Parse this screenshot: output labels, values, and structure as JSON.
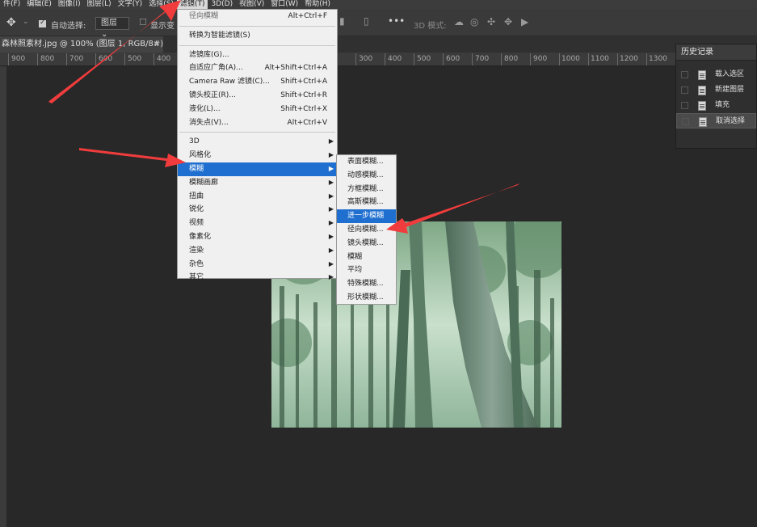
{
  "menubar": {
    "items": [
      "件(F)",
      "编辑(E)",
      "图像(I)",
      "图层(L)",
      "文字(Y)",
      "选择(S)",
      "滤镜(T)",
      "3D(D)",
      "视图(V)",
      "窗口(W)",
      "帮助(H)"
    ]
  },
  "options": {
    "auto_select_label": "自动选择:",
    "auto_select_value": "图层",
    "show_transform_label": "显示变",
    "mode_3d_label": "3D 模式:"
  },
  "document_tab": {
    "title": "森林照素材.jpg @ 100% (图层 1, RGB/8#) *",
    "close": "×"
  },
  "ruler": {
    "labels": [
      "900",
      "800",
      "700",
      "600",
      "500",
      "400",
      "300",
      "400",
      "500",
      "600",
      "700",
      "800",
      "900",
      "1000",
      "1100",
      "1200",
      "1300"
    ]
  },
  "history": {
    "title": "历史记录",
    "items": [
      "载入选区",
      "新建图层",
      "填充",
      "取消选择"
    ]
  },
  "filter_menu": {
    "items": [
      {
        "label": "径向模糊",
        "shortcut": "Alt+Ctrl+F"
      },
      {
        "label": "转换为智能滤镜(S)",
        "shortcut": ""
      },
      {
        "label": "滤镜库(G)...",
        "shortcut": ""
      },
      {
        "label": "自适应广角(A)...",
        "shortcut": "Alt+Shift+Ctrl+A"
      },
      {
        "label": "Camera Raw 滤镜(C)...",
        "shortcut": "Shift+Ctrl+A"
      },
      {
        "label": "镜头校正(R)...",
        "shortcut": "Shift+Ctrl+R"
      },
      {
        "label": "液化(L)...",
        "shortcut": "Shift+Ctrl+X"
      },
      {
        "label": "消失点(V)...",
        "shortcut": "Alt+Ctrl+V"
      },
      {
        "label": "3D"
      },
      {
        "label": "风格化"
      },
      {
        "label": "模糊"
      },
      {
        "label": "模糊画廊"
      },
      {
        "label": "扭曲"
      },
      {
        "label": "锐化"
      },
      {
        "label": "视频"
      },
      {
        "label": "像素化"
      },
      {
        "label": "渲染"
      },
      {
        "label": "杂色"
      },
      {
        "label": "其它"
      }
    ]
  },
  "blur_submenu": {
    "items": [
      "表面模糊...",
      "动感模糊...",
      "方框模糊...",
      "高斯模糊...",
      "进一步模糊",
      "径向模糊...",
      "镜头模糊...",
      "模糊",
      "平均",
      "特殊模糊...",
      "形状模糊..."
    ]
  },
  "colors": {
    "highlight": "#1f6fd0",
    "annotation_arrow": "#f03c3c"
  }
}
